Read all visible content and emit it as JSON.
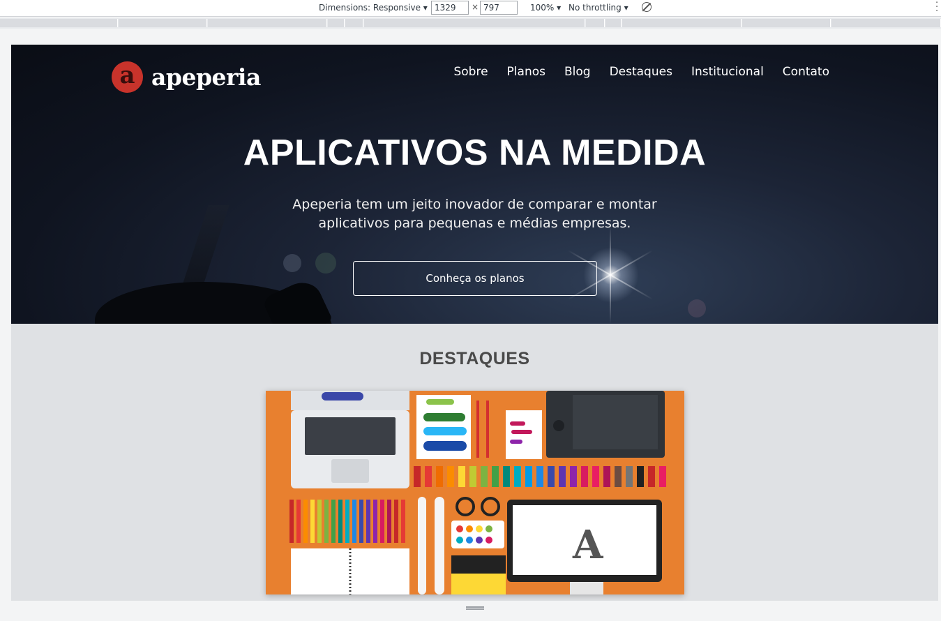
{
  "devtools": {
    "dimensions_label": "Dimensions: Responsive",
    "width_value": "1329",
    "times_sign": "×",
    "height_value": "797",
    "zoom": "100%",
    "throttling": "No throttling"
  },
  "header": {
    "logo_letter": "a",
    "logo_text": "apeperia",
    "nav": [
      "Sobre",
      "Planos",
      "Blog",
      "Destaques",
      "Institucional",
      "Contato"
    ]
  },
  "hero": {
    "title": "APLICATIVOS NA MEDIDA",
    "subtitle": "Apeperia tem um jeito inovador de comparar e montar aplicativos para pequenas e médias empresas.",
    "cta": "Conheça os planos"
  },
  "highlights": {
    "title": "DESTAQUES",
    "image_alt": "designer tools flat illustration"
  },
  "colors": {
    "brand_red": "#c8332b",
    "feature_orange": "#e8802f",
    "page_gray": "#dfe1e4"
  }
}
